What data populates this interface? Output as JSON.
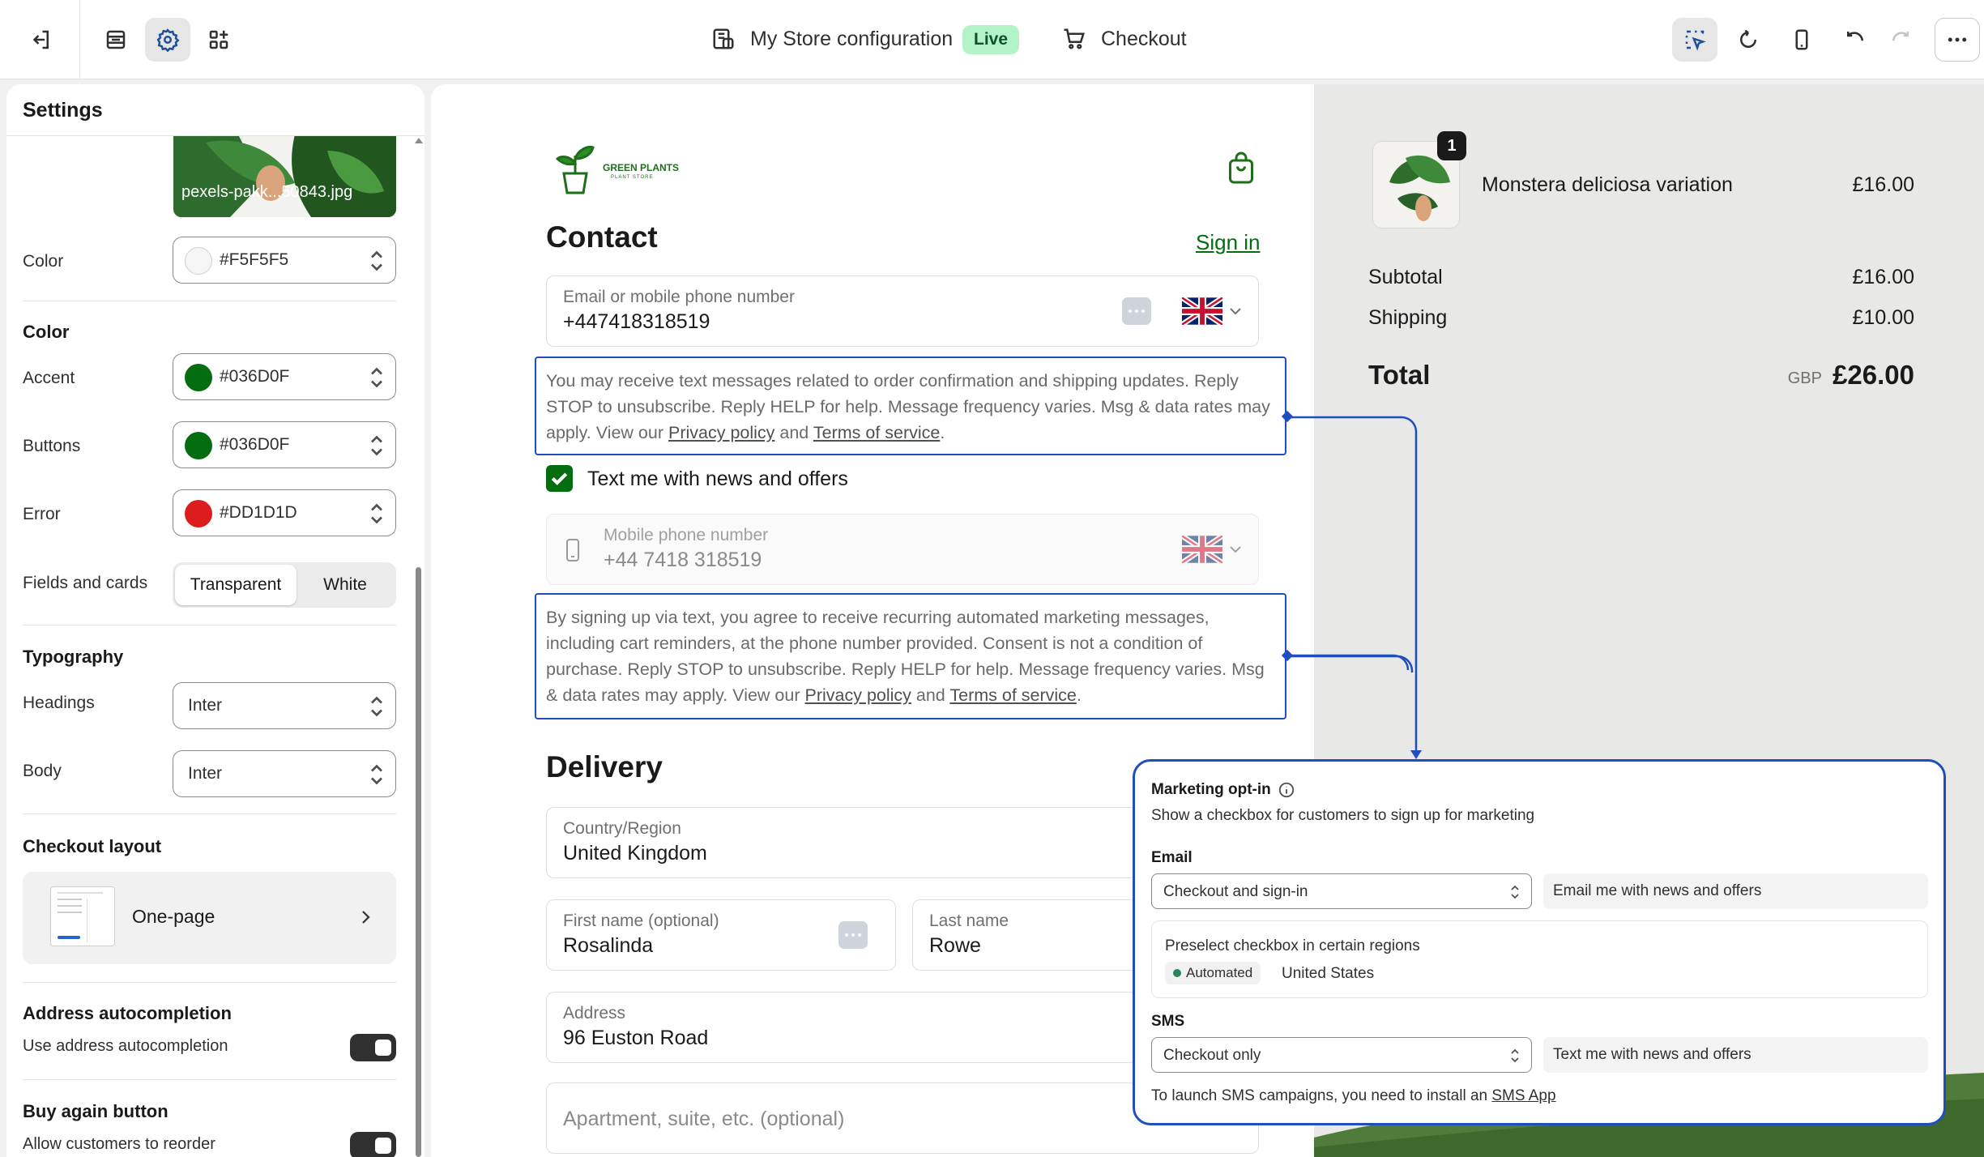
{
  "topbar": {
    "store_name": "My Store configuration",
    "live_badge": "Live",
    "page_name": "Checkout"
  },
  "settings": {
    "title": "Settings",
    "image_filename": "pexels-pakk...50843.jpg",
    "bg_color_label": "Color",
    "bg_color_value": "#F5F5F5",
    "color_section": "Color",
    "accent_label": "Accent",
    "accent_value": "#036D0F",
    "buttons_label": "Buttons",
    "buttons_value": "#036D0F",
    "error_label": "Error",
    "error_value": "#DD1D1D",
    "fields_label": "Fields and cards",
    "fields_options": [
      "Transparent",
      "White"
    ],
    "fields_selected": "Transparent",
    "typography_section": "Typography",
    "headings_label": "Headings",
    "headings_value": "Inter",
    "body_label": "Body",
    "body_value": "Inter",
    "layout_section": "Checkout layout",
    "layout_value": "One-page",
    "autocomplete_section": "Address autocompletion",
    "autocomplete_label": "Use address autocompletion",
    "autocomplete_on": true,
    "buyagain_section": "Buy again button",
    "buyagain_label": "Allow customers to reorder",
    "buyagain_on": true,
    "colors": {
      "bg": "#F5F5F5",
      "accent": "#036D0F",
      "buttons": "#036D0F",
      "error": "#DD1D1D"
    }
  },
  "checkout": {
    "logo_name": "GREEN PLANTS",
    "logo_sub": "PLANT STORE",
    "contact_title": "Contact",
    "sign_in": "Sign in",
    "email_label": "Email or mobile phone number",
    "email_value": "+447418318519",
    "sms_notice_pre": "You may receive text messages related to order confirmation and shipping updates. Reply STOP to unsubscribe. Reply HELP for help. Message frequency varies. Msg & data rates may apply. View our ",
    "privacy_policy": "Privacy policy",
    "and": " and ",
    "terms": "Terms of service",
    "period": ".",
    "text_me_label": "Text me with news and offers",
    "text_me_checked": true,
    "mobile_label": "Mobile phone number",
    "mobile_value": "+44 7418 318519",
    "consent_pre": "By signing up via text, you agree to receive recurring automated marketing messages, including cart reminders, at the phone number provided. Consent is not a condition of purchase. Reply STOP to unsubscribe. Reply HELP for help. Message frequency varies. Msg & data rates may apply. View our ",
    "delivery_title": "Delivery",
    "country_label": "Country/Region",
    "country_value": "United Kingdom",
    "first_name_label": "First name (optional)",
    "first_name_value": "Rosalinda",
    "last_name_label": "Last name",
    "last_name_value": "Rowe",
    "address_label": "Address",
    "address_value": "96 Euston Road",
    "apartment_placeholder": "Apartment, suite, etc. (optional)"
  },
  "summary": {
    "item_name": "Monstera deliciosa variation",
    "item_price": "£16.00",
    "item_qty": "1",
    "subtotal_label": "Subtotal",
    "subtotal_value": "£16.00",
    "shipping_label": "Shipping",
    "shipping_value": "£10.00",
    "total_label": "Total",
    "currency": "GBP",
    "total_value": "£26.00"
  },
  "popover": {
    "title": "Marketing opt-in",
    "description": "Show a checkbox for customers to sign up for marketing",
    "email_label": "Email",
    "email_select": "Checkout and sign-in",
    "email_checkbox_text": "Email me with news and offers",
    "preselect_label": "Preselect checkbox in certain regions",
    "automated_badge": "Automated",
    "region": "United States",
    "sms_label": "SMS",
    "sms_select": "Checkout only",
    "sms_checkbox_text": "Text me with news and offers",
    "footer_pre": "To launch SMS campaigns, you need to install an ",
    "footer_link": "SMS App"
  }
}
